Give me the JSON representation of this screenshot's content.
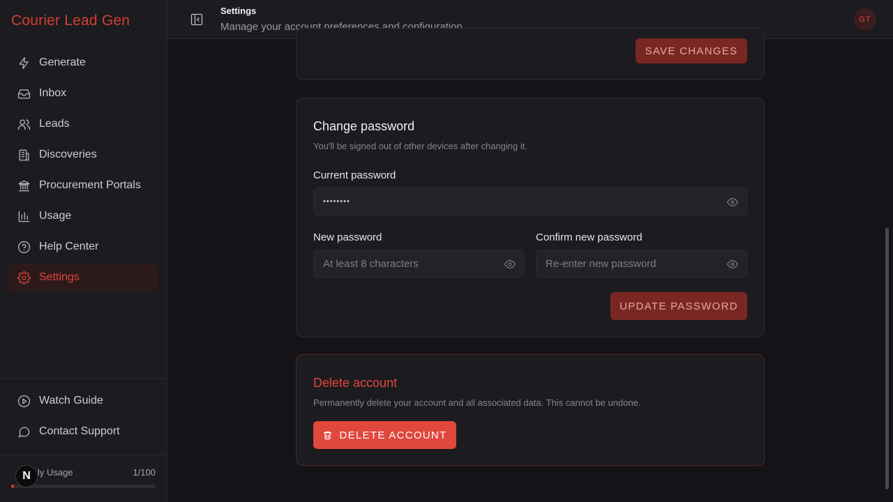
{
  "app": {
    "brand": "Courier Lead Gen"
  },
  "sidebar": {
    "items": [
      {
        "label": "Generate",
        "icon": "bolt-icon"
      },
      {
        "label": "Inbox",
        "icon": "inbox-icon"
      },
      {
        "label": "Leads",
        "icon": "users-icon"
      },
      {
        "label": "Discoveries",
        "icon": "building-icon"
      },
      {
        "label": "Procurement Portals",
        "icon": "landmark-icon"
      },
      {
        "label": "Usage",
        "icon": "bar-chart-icon"
      },
      {
        "label": "Help Center",
        "icon": "help-circle-icon"
      },
      {
        "label": "Settings",
        "icon": "gear-icon",
        "active": true
      }
    ],
    "bottom_items": [
      {
        "label": "Watch Guide",
        "icon": "play-circle-icon"
      },
      {
        "label": "Contact Support",
        "icon": "message-circle-icon"
      }
    ],
    "usage": {
      "label_visible": "ly Usage",
      "value": "1/100",
      "fraction": 0.01
    },
    "badge_letter": "N"
  },
  "header": {
    "title": "Settings",
    "subtitle": "Manage your account preferences and configuration.",
    "avatar_initials": "GT"
  },
  "profile_card": {
    "save_label": "SAVE CHANGES"
  },
  "password_card": {
    "title": "Change password",
    "description": "You'll be signed out of other devices after changing it.",
    "current_label": "Current password",
    "current_value": "••••••••",
    "new_label": "New password",
    "new_placeholder": "At least 8 characters",
    "confirm_label": "Confirm new password",
    "confirm_placeholder": "Re-enter new password",
    "update_label": "UPDATE PASSWORD"
  },
  "delete_card": {
    "title": "Delete account",
    "description": "Permanently delete your account and all associated data. This cannot be undone.",
    "button_label": "DELETE ACCOUNT"
  },
  "colors": {
    "accent": "#e0443a",
    "brand": "#d23f33",
    "background": "#141317",
    "surface": "#1c1b1f"
  }
}
